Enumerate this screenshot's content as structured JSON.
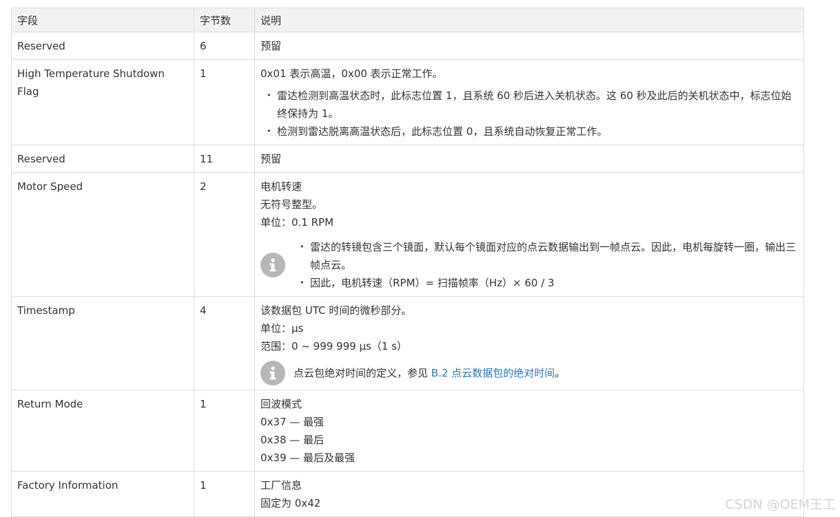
{
  "headers": {
    "field": "字段",
    "bytes": "字节数",
    "desc": "说明"
  },
  "rows": [
    {
      "field": "Reserved",
      "bytes": "6",
      "desc": "预留"
    },
    {
      "field": "High Temperature Shutdown Flag",
      "bytes": "1",
      "desc": "0x01 表示高温，0x00 表示正常工作。",
      "bullets": [
        "雷达检测到高温状态时，此标志位置 1，且系统 60 秒后进入关机状态。这 60 秒及此后的关机状态中，标志位始终保持为 1。",
        "检测到雷达脱离高温状态后，此标志位置 0，且系统自动恢复正常工作。"
      ]
    },
    {
      "field": "Reserved",
      "bytes": "11",
      "desc": "预留"
    },
    {
      "field": "Motor Speed",
      "bytes": "2",
      "lines": [
        "电机转速",
        "无符号整型。",
        "单位：0.1 RPM"
      ],
      "note_bullets": [
        "雷达的转镜包含三个镜面，默认每个镜面对应的点云数据输出到一帧点云。因此，电机每旋转一圈，输出三帧点云。",
        "因此，电机转速（RPM）= 扫描帧率（Hz）× 60 / 3"
      ],
      "note_icon": "info-icon"
    },
    {
      "field": "Timestamp",
      "bytes": "4",
      "lines": [
        "该数据包 UTC 时间的微秒部分。",
        "单位：µs",
        "范围：0 ~ 999 999 µs（1 s）"
      ],
      "note_text": "点云包绝对时间的定义，参见 ",
      "note_link": "B.2 点云数据包的绝对时间",
      "note_end": "。",
      "note_icon": "info-icon"
    },
    {
      "field": "Return Mode",
      "bytes": "1",
      "lines": [
        "回波模式",
        "0x37 — 最强",
        "0x38 — 最后",
        "0x39 — 最后及最强"
      ]
    },
    {
      "field": "Factory Information",
      "bytes": "1",
      "lines": [
        "工厂信息",
        "固定为 0x42"
      ]
    }
  ],
  "watermark": "CSDN @OEM王工",
  "colors": {
    "link": "#2a7ab8",
    "header_bg": "#f2f2f2",
    "border": "#dcdcdc",
    "icon_bg": "#b7b7b7"
  }
}
